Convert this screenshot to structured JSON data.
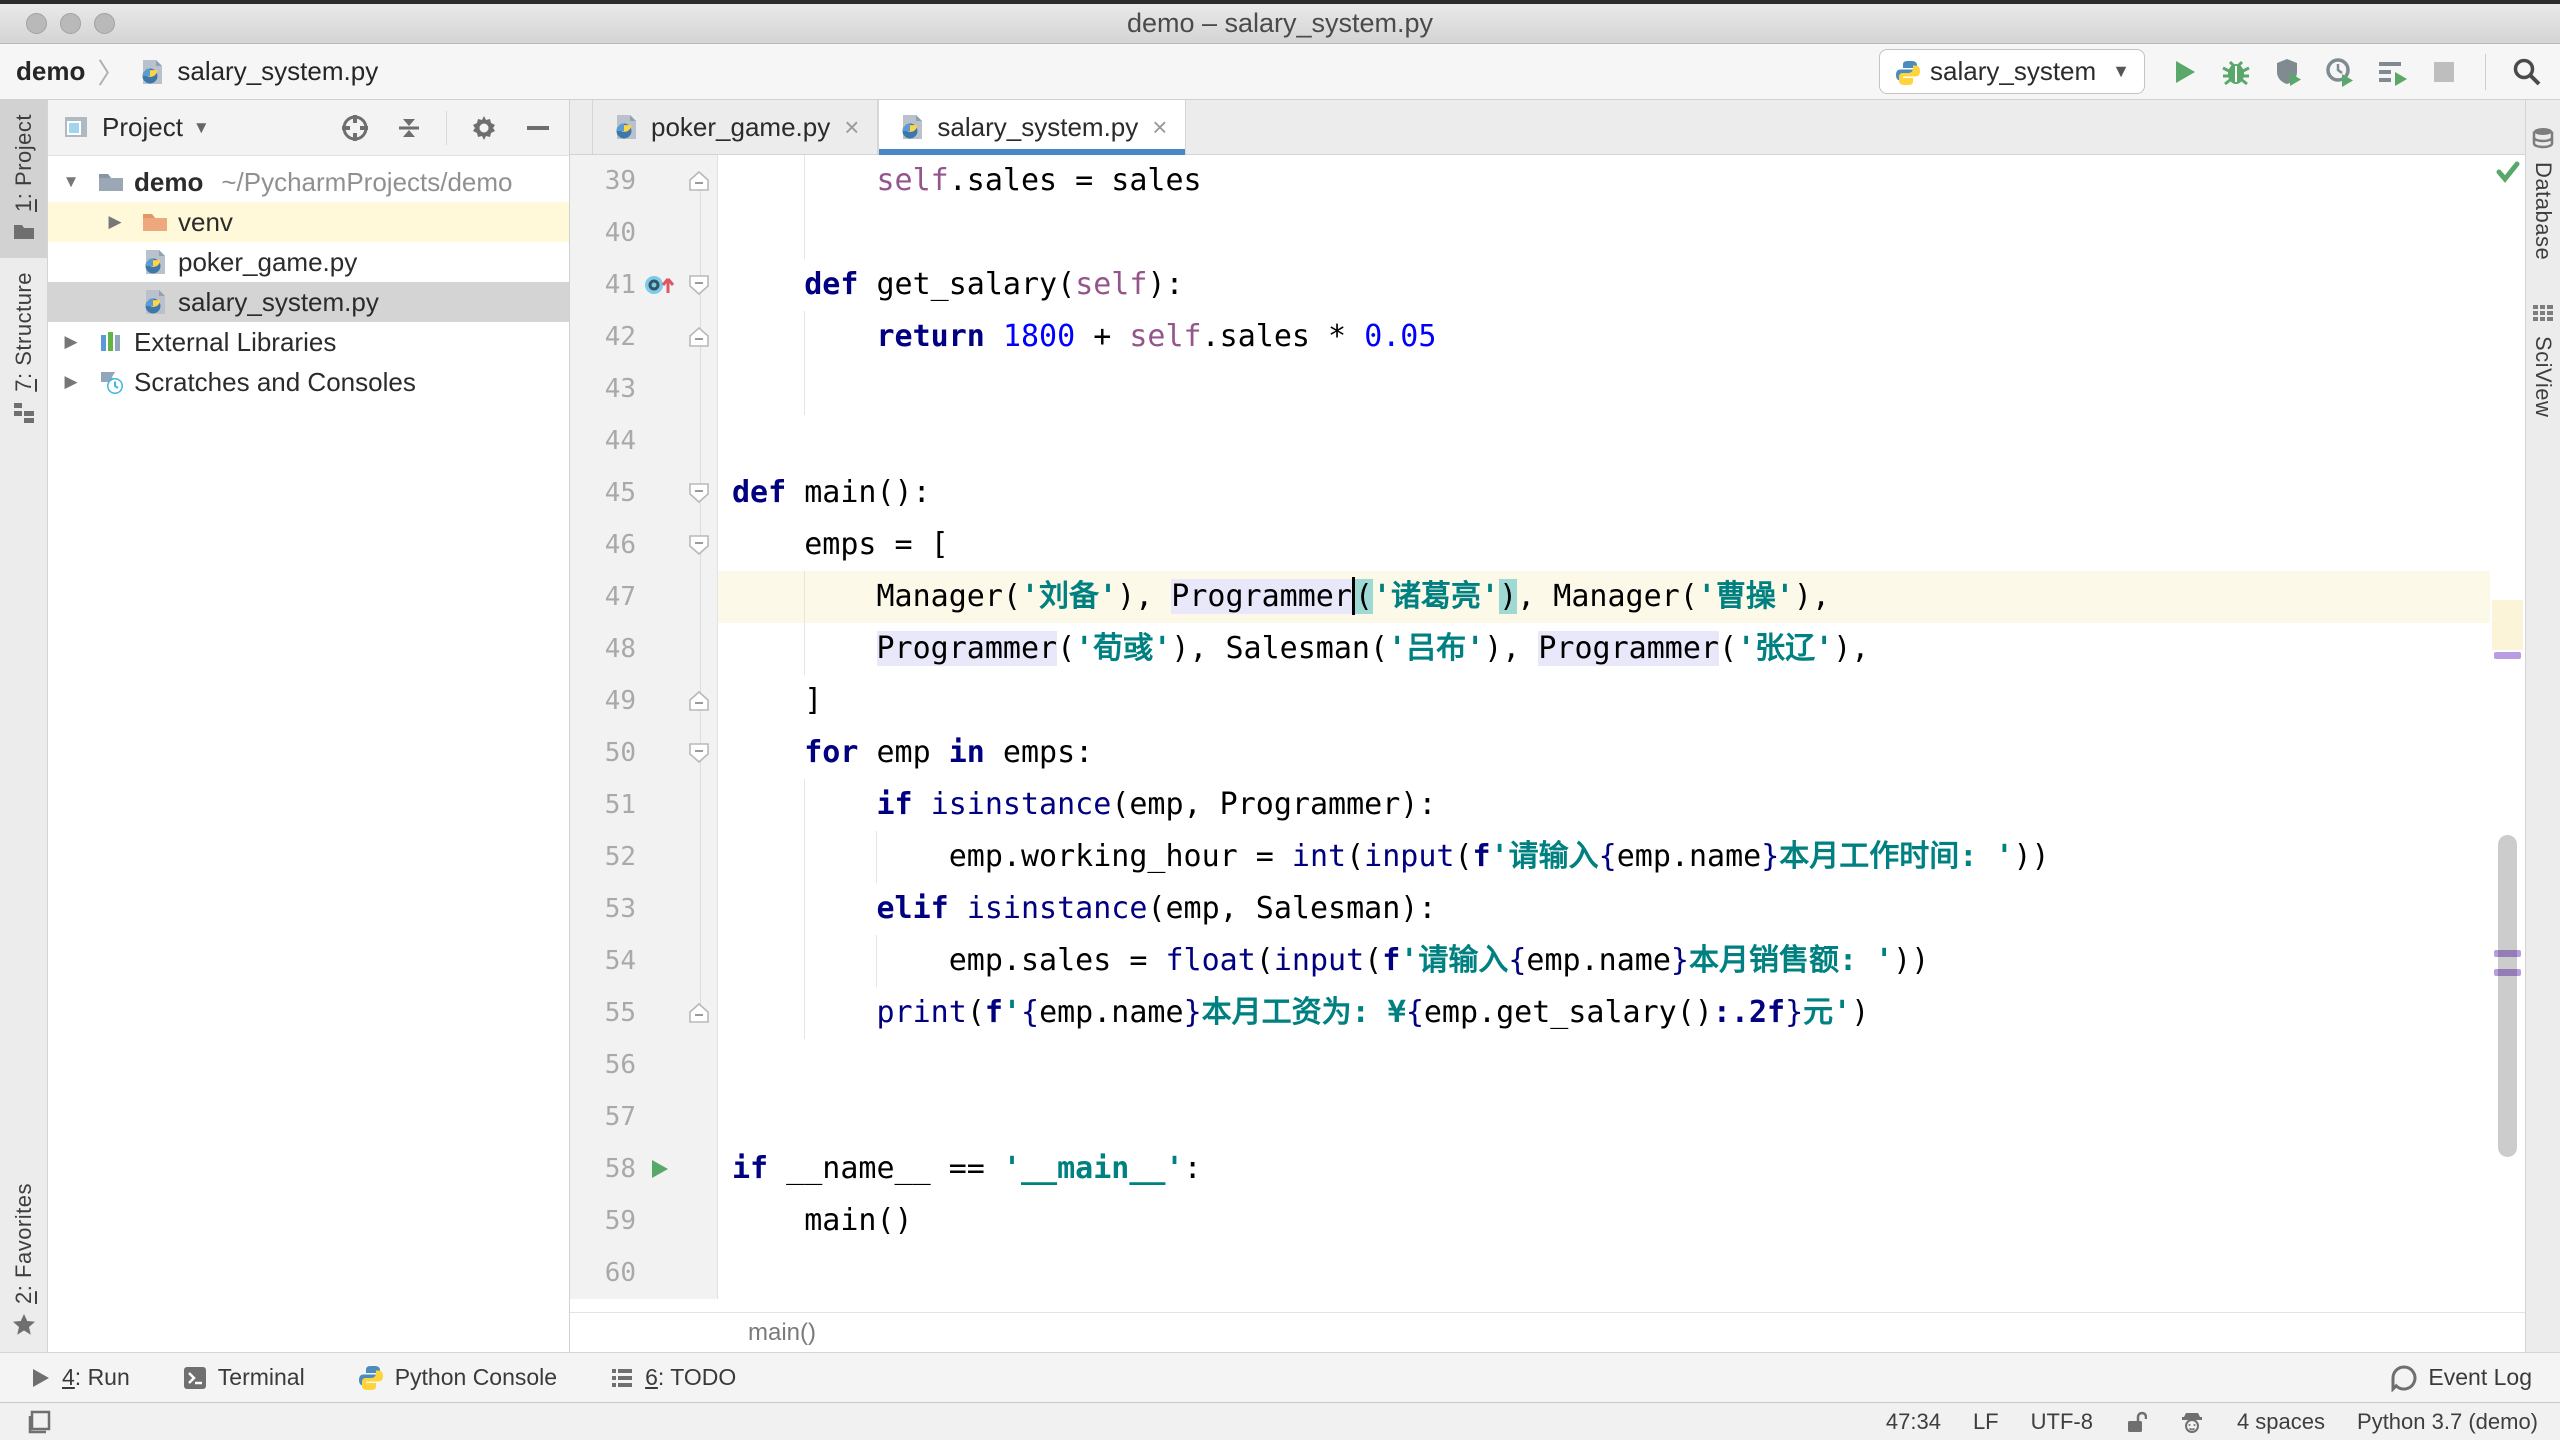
{
  "window": {
    "title": "demo – salary_system.py"
  },
  "topbar": {
    "breadcrumb": {
      "project": "demo",
      "file": "salary_system.py",
      "file_icon": "python-file-icon"
    },
    "run_config": {
      "label": "salary_system",
      "icon": "python-logo-icon"
    },
    "actions": [
      {
        "name": "run-button",
        "icon": "run-icon"
      },
      {
        "name": "debug-button",
        "icon": "debug-bug-icon"
      },
      {
        "name": "run-coverage-button",
        "icon": "coverage-shield-icon"
      },
      {
        "name": "profiler-button",
        "icon": "profiler-clock-icon"
      },
      {
        "name": "concurrency-diagram-button",
        "icon": "concurrency-icon"
      },
      {
        "name": "stop-button",
        "icon": "stop-icon",
        "disabled": true
      },
      {
        "name": "search-everywhere-button",
        "icon": "search-icon",
        "sep_before": true
      }
    ]
  },
  "left_stripe": [
    {
      "num": "1",
      "rest": ": Project",
      "icon": "project-folder-icon",
      "active": true
    },
    {
      "num": "7",
      "rest": ": Structure",
      "icon": "structure-icon"
    },
    {
      "num": "2",
      "rest": ": Favorites",
      "icon": "star-icon",
      "bottom": true
    }
  ],
  "right_stripe": [
    {
      "label": "Database",
      "icon": "database-icon"
    },
    {
      "label": "SciView",
      "icon": "sciview-grid-icon"
    }
  ],
  "project_panel": {
    "title": "Project",
    "tree": [
      {
        "arrow": "down",
        "icon": "folder-icon",
        "label": "demo",
        "bold": true,
        "suffix": "~/PycharmProjects/demo",
        "indent": 0
      },
      {
        "arrow": "right",
        "icon": "excluded-folder-icon",
        "label": "venv",
        "indent": 1,
        "highlight": "yellow"
      },
      {
        "icon": "python-file-icon",
        "label": "poker_game.py",
        "indent": 1
      },
      {
        "icon": "python-file-icon",
        "label": "salary_system.py",
        "indent": 1,
        "selected": true
      },
      {
        "arrow": "right",
        "icon": "external-libraries-icon",
        "label": "External Libraries",
        "indent": 0
      },
      {
        "arrow": "right",
        "icon": "scratches-icon",
        "label": "Scratches and Consoles",
        "indent": 0
      }
    ]
  },
  "tabs": [
    {
      "label": "poker_game.py",
      "icon": "python-file-icon",
      "active": false
    },
    {
      "label": "salary_system.py",
      "icon": "python-file-icon",
      "active": true
    }
  ],
  "editor": {
    "bottom_breadcrumb": "main()",
    "lines": [
      {
        "n": 39,
        "fold": "up",
        "guides": [
          4
        ],
        "tokens": [
          [
            "p",
            "        "
          ],
          [
            "self",
            "self"
          ],
          [
            "p",
            ".sales = sales"
          ]
        ]
      },
      {
        "n": 40,
        "guides": [
          4
        ],
        "tokens": []
      },
      {
        "n": 41,
        "fold": "down",
        "gicon": "override-method-icon",
        "guides": [],
        "tokens": [
          [
            "p",
            "    "
          ],
          [
            "kw",
            "def"
          ],
          [
            "p",
            " get_salary("
          ],
          [
            "self",
            "self"
          ],
          [
            "p",
            "):"
          ]
        ]
      },
      {
        "n": 42,
        "fold": "up",
        "guides": [
          4
        ],
        "tokens": [
          [
            "p",
            "        "
          ],
          [
            "kw",
            "return"
          ],
          [
            "p",
            " "
          ],
          [
            "num",
            "1800"
          ],
          [
            "p",
            " + "
          ],
          [
            "self",
            "self"
          ],
          [
            "p",
            ".sales * "
          ],
          [
            "num",
            "0.05"
          ]
        ]
      },
      {
        "n": 43,
        "guides": [
          4
        ],
        "tokens": []
      },
      {
        "n": 44,
        "guides": [],
        "tokens": []
      },
      {
        "n": 45,
        "fold": "down",
        "guides": [],
        "tokens": [
          [
            "kw",
            "def"
          ],
          [
            "p",
            " main():"
          ]
        ]
      },
      {
        "n": 46,
        "fold": "down",
        "guides": [],
        "tokens": [
          [
            "p",
            "    emps = ["
          ]
        ]
      },
      {
        "n": 47,
        "current": true,
        "guides": [
          4
        ],
        "tokens": [
          [
            "p",
            "        Manager("
          ],
          [
            "str",
            "'刘备'"
          ],
          [
            "p",
            "), "
          ],
          [
            "p",
            "Programmer",
            "hl-id"
          ],
          [
            "caret",
            ""
          ],
          [
            "p",
            "(",
            "hl-brace"
          ],
          [
            "str",
            "'诸葛亮'"
          ],
          [
            "p",
            ")",
            "hl-brace"
          ],
          [
            "p",
            ", Manager("
          ],
          [
            "str",
            "'曹操'"
          ],
          [
            "p",
            "),"
          ]
        ]
      },
      {
        "n": 48,
        "guides": [
          4
        ],
        "tokens": [
          [
            "p",
            "        "
          ],
          [
            "p",
            "Programmer",
            "hl-id"
          ],
          [
            "p",
            "("
          ],
          [
            "str",
            "'荀彧'"
          ],
          [
            "p",
            "), Salesman("
          ],
          [
            "str",
            "'吕布'"
          ],
          [
            "p",
            "), "
          ],
          [
            "p",
            "Programmer",
            "hl-id"
          ],
          [
            "p",
            "("
          ],
          [
            "str",
            "'张辽'"
          ],
          [
            "p",
            "),"
          ]
        ]
      },
      {
        "n": 49,
        "fold": "up",
        "guides": [],
        "tokens": [
          [
            "p",
            "    ]"
          ]
        ]
      },
      {
        "n": 50,
        "fold": "down",
        "guides": [],
        "tokens": [
          [
            "p",
            "    "
          ],
          [
            "kw",
            "for"
          ],
          [
            "p",
            " emp "
          ],
          [
            "kw",
            "in"
          ],
          [
            "p",
            " emps:"
          ]
        ]
      },
      {
        "n": 51,
        "guides": [
          4
        ],
        "tokens": [
          [
            "p",
            "        "
          ],
          [
            "kw",
            "if"
          ],
          [
            "p",
            " "
          ],
          [
            "bi",
            "isinstance"
          ],
          [
            "p",
            "(emp, Programmer):"
          ]
        ]
      },
      {
        "n": 52,
        "guides": [
          4,
          8
        ],
        "tokens": [
          [
            "p",
            "            emp.working_hour = "
          ],
          [
            "bi",
            "int"
          ],
          [
            "p",
            "("
          ],
          [
            "bi",
            "input"
          ],
          [
            "p",
            "("
          ],
          [
            "kw",
            "f"
          ],
          [
            "str",
            "'请输入"
          ],
          [
            "br",
            "{"
          ],
          [
            "p",
            "emp.name"
          ],
          [
            "br",
            "}"
          ],
          [
            "str",
            "本月工作时间: '"
          ],
          [
            "p",
            "))"
          ]
        ]
      },
      {
        "n": 53,
        "guides": [
          4
        ],
        "tokens": [
          [
            "p",
            "        "
          ],
          [
            "kw",
            "elif"
          ],
          [
            "p",
            " "
          ],
          [
            "bi",
            "isinstance"
          ],
          [
            "p",
            "(emp, Salesman):"
          ]
        ]
      },
      {
        "n": 54,
        "guides": [
          4,
          8
        ],
        "tokens": [
          [
            "p",
            "            emp.sales = "
          ],
          [
            "bi",
            "float"
          ],
          [
            "p",
            "("
          ],
          [
            "bi",
            "input"
          ],
          [
            "p",
            "("
          ],
          [
            "kw",
            "f"
          ],
          [
            "str",
            "'请输入"
          ],
          [
            "br",
            "{"
          ],
          [
            "p",
            "emp.name"
          ],
          [
            "br",
            "}"
          ],
          [
            "str",
            "本月销售额: '"
          ],
          [
            "p",
            "))"
          ]
        ]
      },
      {
        "n": 55,
        "fold": "up",
        "guides": [
          4
        ],
        "tokens": [
          [
            "p",
            "        "
          ],
          [
            "bi",
            "print"
          ],
          [
            "p",
            "("
          ],
          [
            "kw",
            "f"
          ],
          [
            "str",
            "'"
          ],
          [
            "br",
            "{"
          ],
          [
            "p",
            "emp.name"
          ],
          [
            "br",
            "}"
          ],
          [
            "str",
            "本月工资为: ¥"
          ],
          [
            "br",
            "{"
          ],
          [
            "p",
            "emp.get_salary()"
          ],
          [
            "fmt",
            ":.2f"
          ],
          [
            "br",
            "}"
          ],
          [
            "str",
            "元'"
          ],
          [
            "p",
            ")"
          ]
        ]
      },
      {
        "n": 56,
        "guides": [],
        "tokens": []
      },
      {
        "n": 57,
        "guides": [],
        "tokens": []
      },
      {
        "n": 58,
        "gicon": "run-line-icon",
        "guides": [],
        "tokens": [
          [
            "kw",
            "if"
          ],
          [
            "p",
            " __name__ == "
          ],
          [
            "str",
            "'__main__'"
          ],
          [
            "p",
            ":"
          ]
        ]
      },
      {
        "n": 59,
        "guides": [],
        "tokens": [
          [
            "p",
            "    main()"
          ]
        ]
      },
      {
        "n": 60,
        "guides": [],
        "tokens": []
      }
    ]
  },
  "bottom_toolbar": {
    "left": [
      {
        "num": "4",
        "rest": ": Run",
        "icon": "run-toolwindow-icon"
      },
      {
        "rest": "Terminal",
        "icon": "terminal-icon"
      },
      {
        "rest": "Python Console",
        "icon": "python-logo-icon"
      },
      {
        "num": "6",
        "rest": ": TODO",
        "icon": "todo-list-icon"
      }
    ],
    "right": {
      "rest": "Event Log",
      "icon": "event-log-icon"
    }
  },
  "status_bar": {
    "left_icon": "toolwindow-toggle-icon",
    "items": [
      {
        "text": "47:34"
      },
      {
        "text": "LF"
      },
      {
        "text": "UTF-8"
      },
      {
        "icon": "unlock-icon"
      },
      {
        "icon": "highlighting-level-icon"
      },
      {
        "text": "4 spaces"
      },
      {
        "text": "Python 3.7 (demo)"
      }
    ]
  },
  "colors": {
    "accent": "#4A88C7",
    "keyword": "#000080",
    "number": "#0000FF",
    "string": "#008080",
    "self": "#94558D",
    "caret_row": "#FCF9E8",
    "identifier_highlight": "#E9E7FA",
    "brace_match": "#9ED9D3",
    "run_green": "#59A869",
    "stripe_mark": "#BA9CE3",
    "selection_gray": "#D4D4D4",
    "excluded_yellow": "#FFF8D9"
  }
}
